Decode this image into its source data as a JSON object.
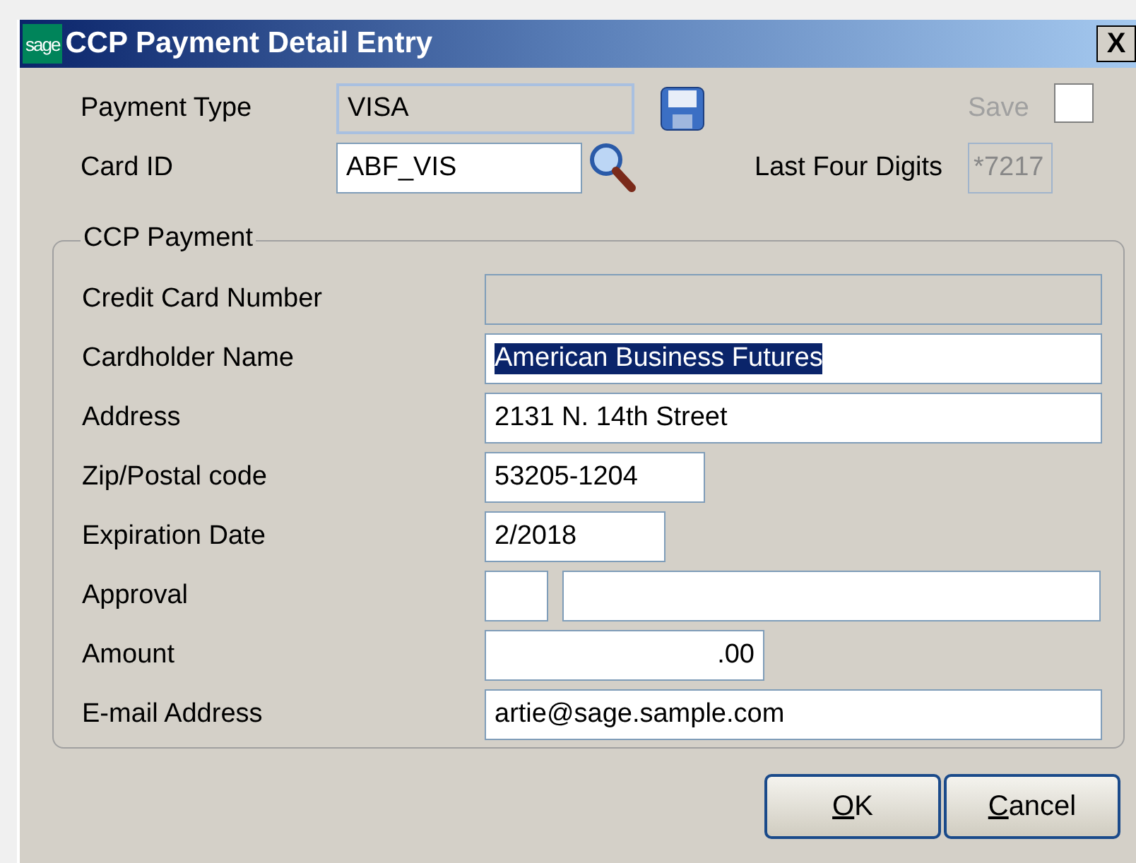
{
  "window": {
    "logo": "sage",
    "title": "CCP Payment Detail Entry",
    "close": "X"
  },
  "payment_type": {
    "label": "Payment Type",
    "value": "VISA",
    "disabled": true
  },
  "card_id": {
    "label": "Card ID",
    "value": "ABF_VIS"
  },
  "save": {
    "label": "Save",
    "checked": false,
    "disabled": true
  },
  "last_four": {
    "label": "Last Four Digits",
    "value": "*7217",
    "disabled": true
  },
  "group": {
    "title": "CCP Payment",
    "rows": [
      {
        "label": "Credit Card Number",
        "fields": [
          {
            "disabled": true
          }
        ]
      },
      {
        "label": "Cardholder Name",
        "fields": [
          {
            "value": "American Business Futures",
            "selected": true,
            "disabled": false
          }
        ]
      },
      {
        "label": "Address",
        "fields": [
          {
            "value": "2131 N. 14th Street",
            "selected": false,
            "disabled": false
          }
        ]
      },
      {
        "label": "Zip/Postal code",
        "fields": [
          {
            "value": "53205-1204",
            "selected": false,
            "disabled": false
          }
        ]
      },
      {
        "label": "Expiration Date",
        "fields": [
          {
            "value": "2/2018",
            "selected": false,
            "disabled": false
          }
        ]
      },
      {
        "label": "Approval",
        "fields": [
          {
            "disabled": false
          },
          {
            "disabled": false
          }
        ]
      },
      {
        "label": "Amount",
        "kind": "amount",
        "fields": [
          {
            "value": ".00",
            "selected": false,
            "disabled": false
          }
        ]
      },
      {
        "label": "E-mail Address",
        "fields": [
          {
            "value": "artie@sage.sample.com",
            "selected": false,
            "disabled": false
          }
        ]
      }
    ]
  },
  "buttons": [
    {
      "label": "OK"
    },
    {
      "label": "Cancel"
    }
  ]
}
